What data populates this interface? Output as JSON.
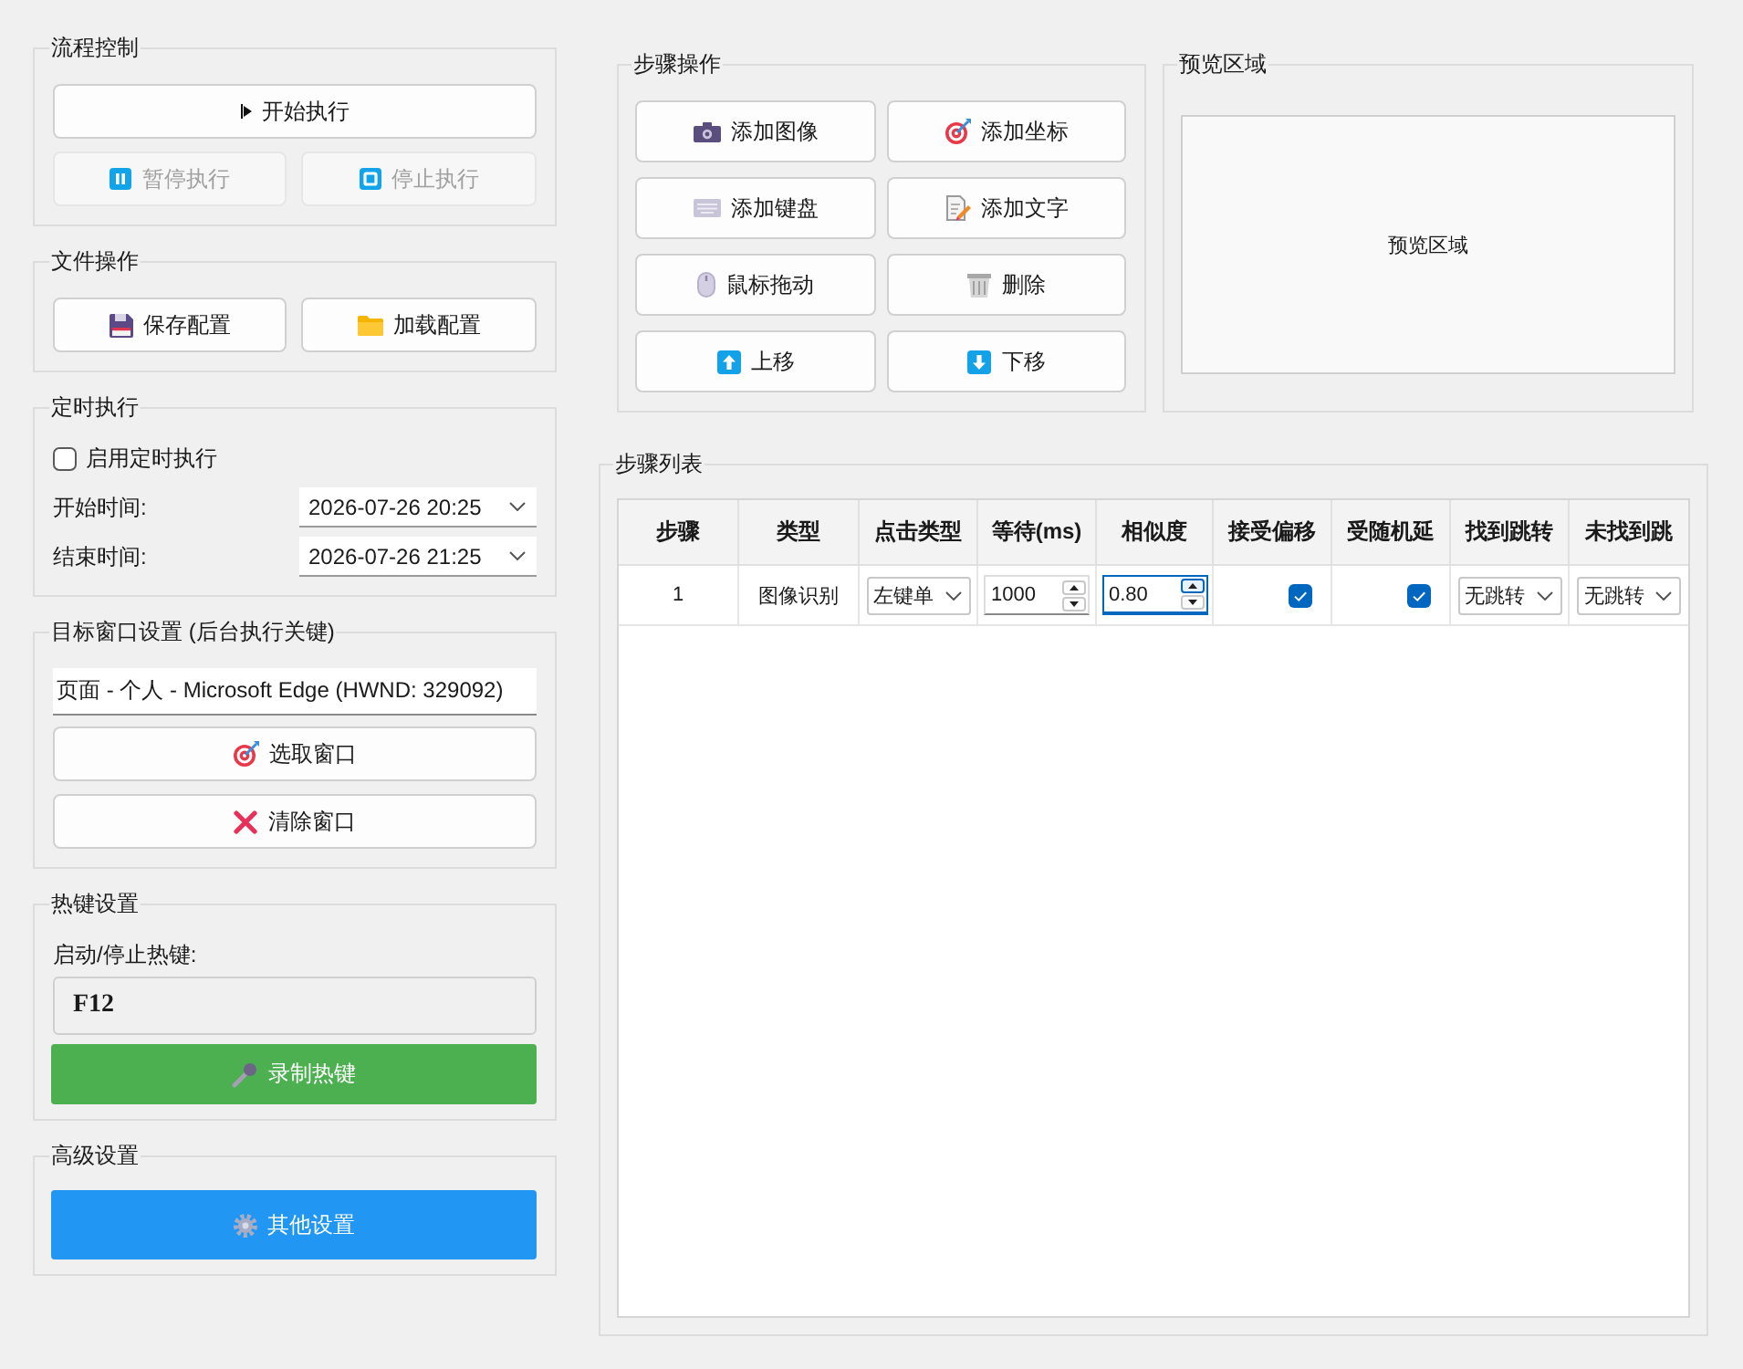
{
  "flow_control": {
    "title": "流程控制",
    "buttons": [
      {
        "label": "开始执行",
        "disabled": false
      },
      {
        "label": "暂停执行",
        "disabled": true
      },
      {
        "label": "停止执行",
        "disabled": true
      }
    ]
  },
  "file_operations": {
    "title": "文件操作",
    "buttons": [
      {
        "label": "保存配置"
      },
      {
        "label": "加载配置"
      }
    ]
  },
  "schedule": {
    "title": "定时执行",
    "enable": {
      "label": "启用定时执行",
      "checked": false
    },
    "fields": [
      {
        "label": "开始时间:",
        "value": "2026-07-26 20:25"
      },
      {
        "label": "结束时间:",
        "value": "2026-07-26 21:25"
      }
    ]
  },
  "target_window": {
    "title": "目标窗口设置 (后台执行关键)",
    "value": "页面 - 个人 - Microsoft Edge (HWND: 329092)",
    "buttons": [
      {
        "label": "选取窗口"
      },
      {
        "label": "清除窗口"
      }
    ]
  },
  "hotkey": {
    "title": "热键设置",
    "label": "启动/停止热键:",
    "value": "F12",
    "button": {
      "label": "录制热键"
    }
  },
  "advanced": {
    "title": "高级设置",
    "button": {
      "label": "其他设置"
    }
  },
  "step_operations": {
    "title": "步骤操作",
    "buttons": [
      {
        "label": "添加图像"
      },
      {
        "label": "添加坐标"
      },
      {
        "label": "添加键盘"
      },
      {
        "label": "添加文字"
      },
      {
        "label": "鼠标拖动"
      },
      {
        "label": "删除"
      },
      {
        "label": "上移"
      },
      {
        "label": "下移"
      }
    ]
  },
  "preview": {
    "title": "预览区域",
    "placeholder": "预览区域"
  },
  "step_list": {
    "title": "步骤列表",
    "columns": [
      "步骤",
      "类型",
      "点击类型",
      "等待(ms)",
      "相似度",
      "接受偏移",
      "受随机延",
      "找到跳转",
      "未找到跳"
    ],
    "rows": [
      {
        "step": "1",
        "type": "图像识别",
        "click_type": "左键单",
        "wait": {
          "value": "1000",
          "focused": false
        },
        "similarity": {
          "value": "0.80",
          "focused": true
        },
        "accept_offset": true,
        "random_delay": true,
        "on_found": "无跳转",
        "on_not_found": "无跳转"
      }
    ]
  }
}
